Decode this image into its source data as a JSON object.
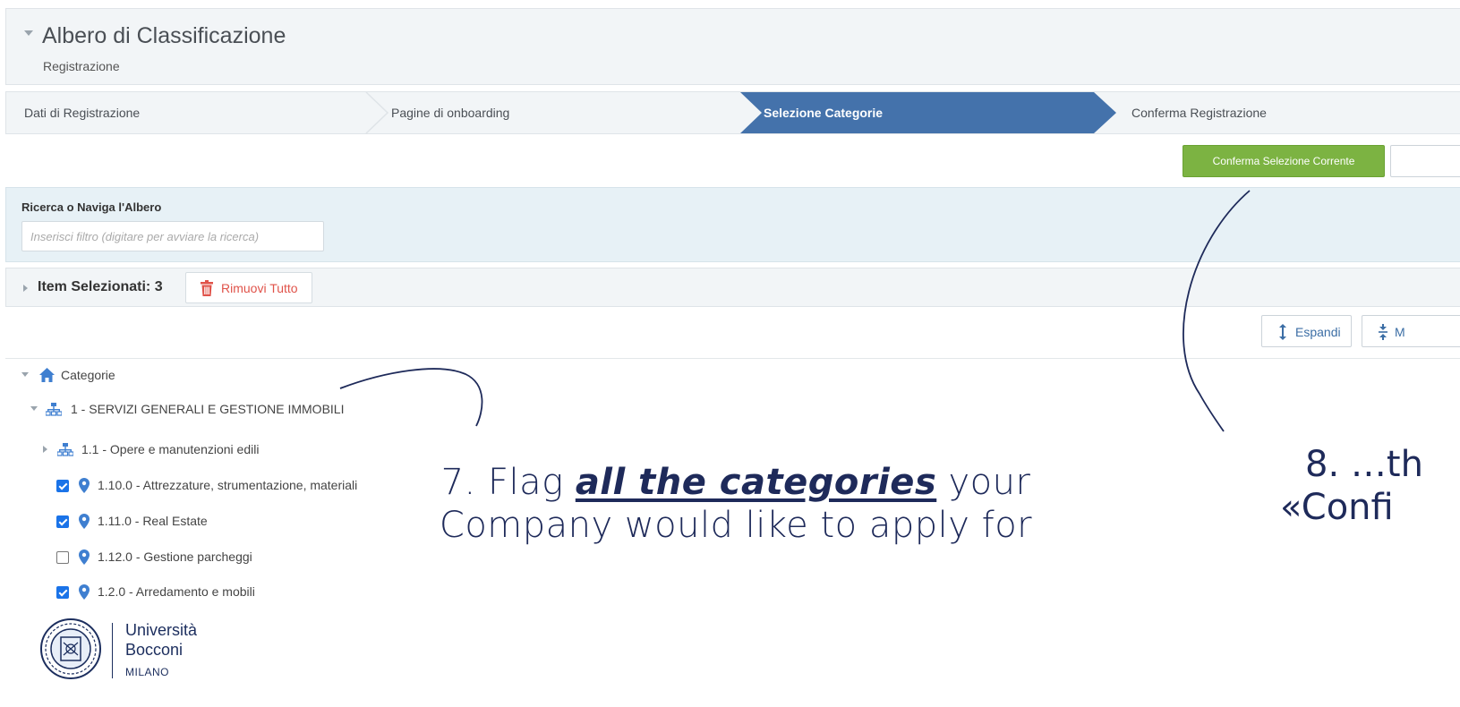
{
  "header": {
    "title": "Albero di Classificazione",
    "subtitle": "Registrazione"
  },
  "wizard": {
    "steps": [
      {
        "label": "Dati di Registrazione",
        "active": false
      },
      {
        "label": "Pagine di onboarding",
        "active": false
      },
      {
        "label": "Selezione Categorie",
        "active": true
      },
      {
        "label": "Conferma Registrazione",
        "active": false
      }
    ]
  },
  "toolbar": {
    "confirm_label": "Conferma Selezione Corrente"
  },
  "search": {
    "label": "Ricerca o Naviga l'Albero",
    "placeholder": "Inserisci filtro (digitare per avviare la ricerca)"
  },
  "selected": {
    "label": "Item Selezionati: 3",
    "remove_all_label": "Rimuovi Tutto"
  },
  "tree_controls": {
    "expand_label": "Espandi",
    "collapse_label": "M"
  },
  "tree": {
    "root": "Categorie",
    "group": "1 - SERVIZI GENERALI E GESTIONE IMMOBILI",
    "subgroup": "1.1 - Opere e manutenzioni edili",
    "items": [
      {
        "label": "1.10.0 - Attrezzature, strumentazione, materiali",
        "checked": true
      },
      {
        "label": "1.11.0 - Real Estate",
        "checked": true
      },
      {
        "label": "1.12.0 - Gestione parcheggi",
        "checked": false
      },
      {
        "label": "1.2.0 - Arredamento e mobili",
        "checked": true
      }
    ]
  },
  "annotations": {
    "step7_prefix": "7. Flag ",
    "step7_emphasis": "all the categories",
    "step7_suffix": " your",
    "step7_line2": "Company would like to apply for",
    "step8_line1": "8. …th",
    "step8_line2": "«Confi"
  },
  "logo": {
    "line1": "Università",
    "line2": "Bocconi",
    "line3": "MILANO"
  },
  "colors": {
    "active_step": "#4472ab",
    "confirm_button": "#7cb342",
    "remove_text": "#e0534a",
    "checkbox": "#1a73e8",
    "annotation_ink": "#1e2a5a"
  }
}
